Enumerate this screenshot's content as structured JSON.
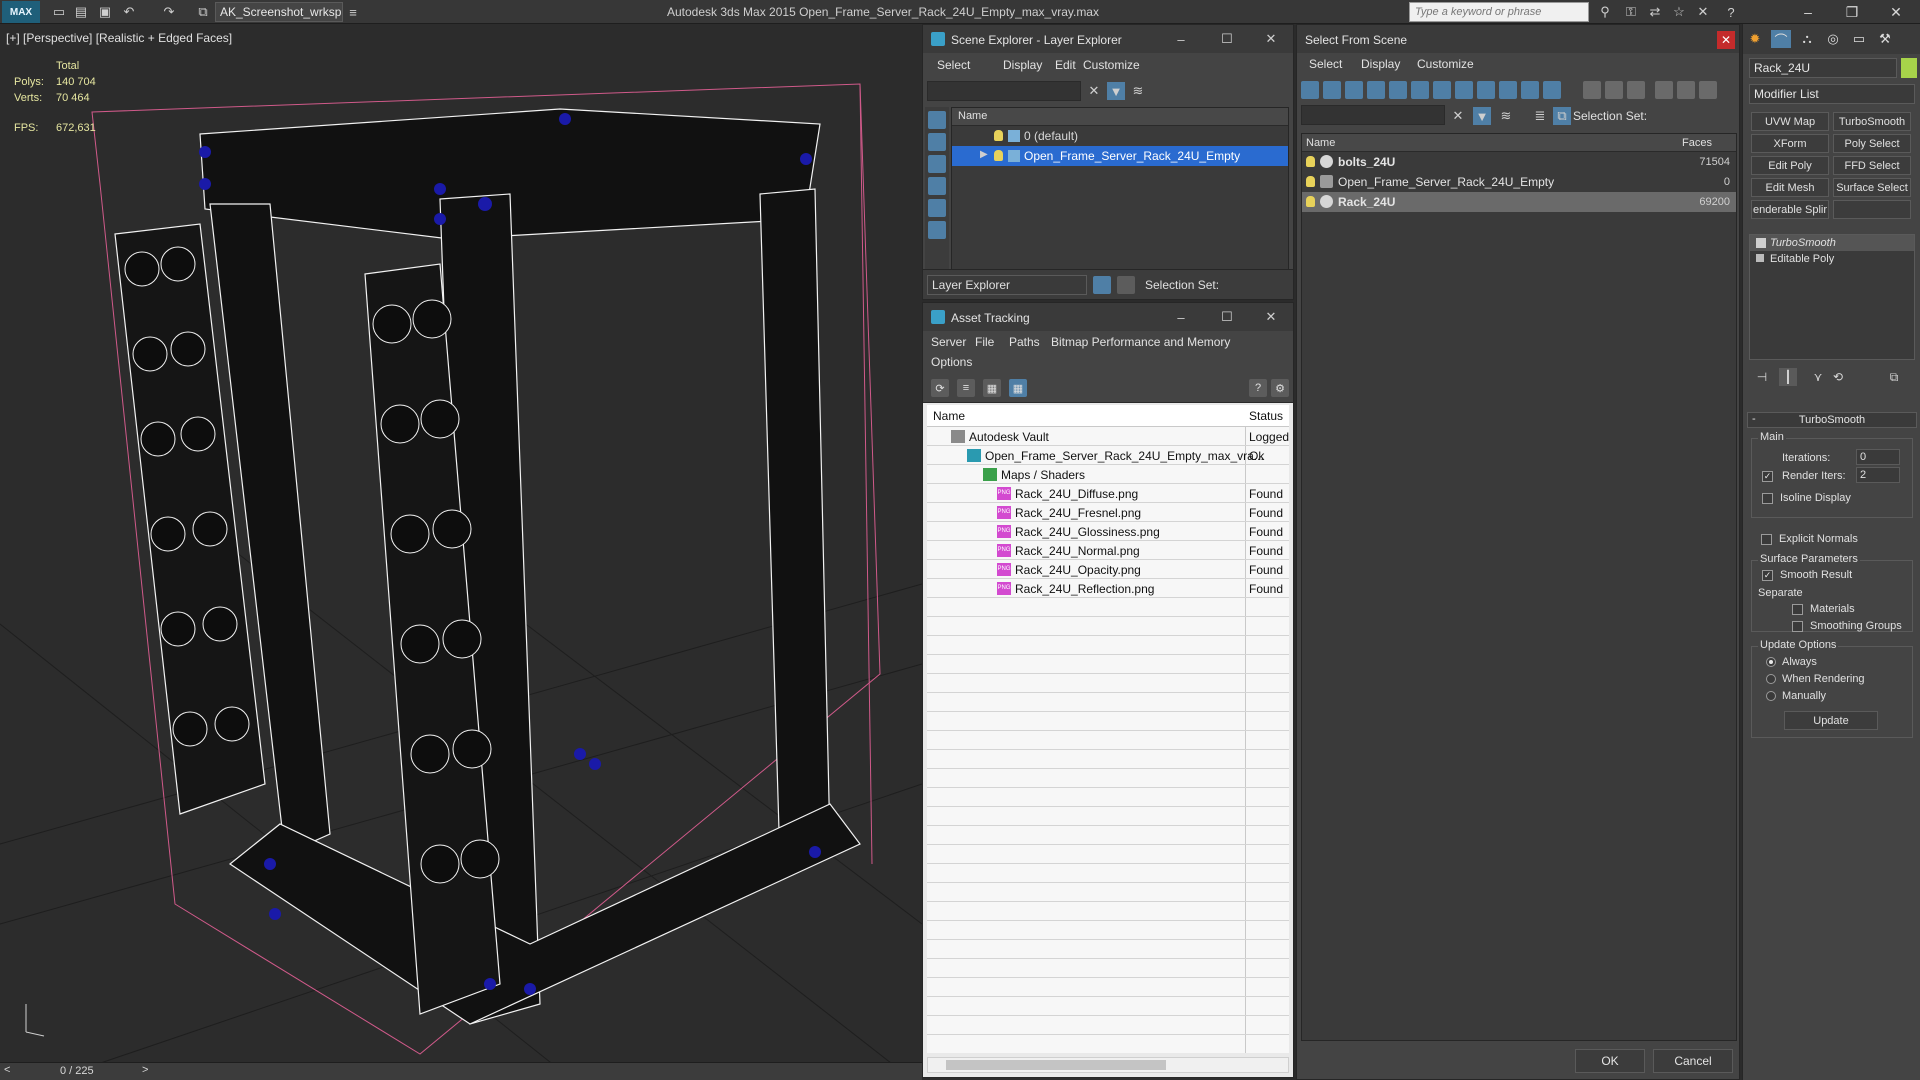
{
  "titlebar": {
    "logo": "MAX",
    "workspace": "AK_Screenshot_wrksp",
    "title": "Autodesk 3ds Max  2015     Open_Frame_Server_Rack_24U_Empty_max_vray.max",
    "search_placeholder": "Type a keyword or phrase"
  },
  "viewport": {
    "label": "[+] [Perspective] [Realistic + Edged Faces]",
    "stats": {
      "total_label": "Total",
      "polys_label": "Polys:",
      "polys": "140 704",
      "verts_label": "Verts:",
      "verts": "70 464",
      "fps_label": "FPS:",
      "fps": "672,631"
    },
    "timeline_frame": "0 / 225"
  },
  "scene_explorer": {
    "title": "Scene Explorer - Layer Explorer",
    "menus": [
      "Select",
      "Display",
      "Edit",
      "Customize"
    ],
    "column_name": "Name",
    "rows": [
      {
        "label": "0 (default)"
      },
      {
        "label": "Open_Frame_Server_Rack_24U_Empty"
      }
    ],
    "footer_dropdown": "Layer Explorer",
    "footer_selection_set": "Selection Set:"
  },
  "asset_tracking": {
    "title": "Asset Tracking",
    "menus": [
      "Server",
      "File",
      "Paths",
      "Bitmap Performance and Memory",
      "Options"
    ],
    "columns": [
      "Name",
      "Status"
    ],
    "rows": [
      {
        "name": "Autodesk Vault",
        "status": "Logged"
      },
      {
        "name": "Open_Frame_Server_Rack_24U_Empty_max_vra...",
        "status": "Ok"
      },
      {
        "name": "Maps / Shaders",
        "status": ""
      },
      {
        "name": "Rack_24U_Diffuse.png",
        "status": "Found"
      },
      {
        "name": "Rack_24U_Fresnel.png",
        "status": "Found"
      },
      {
        "name": "Rack_24U_Glossiness.png",
        "status": "Found"
      },
      {
        "name": "Rack_24U_Normal.png",
        "status": "Found"
      },
      {
        "name": "Rack_24U_Opacity.png",
        "status": "Found"
      },
      {
        "name": "Rack_24U_Reflection.png",
        "status": "Found"
      }
    ],
    "png_badge": "PNG"
  },
  "select_from_scene": {
    "title": "Select From Scene",
    "menus": [
      "Select",
      "Display",
      "Customize"
    ],
    "selection_set": "Selection Set:",
    "columns": [
      "Name",
      "Faces"
    ],
    "rows": [
      {
        "name": "bolts_24U",
        "faces": "71504"
      },
      {
        "name": "Open_Frame_Server_Rack_24U_Empty",
        "faces": "0"
      },
      {
        "name": "Rack_24U",
        "faces": "69200"
      }
    ],
    "ok": "OK",
    "cancel": "Cancel"
  },
  "command_panel": {
    "object_name": "Rack_24U",
    "modifier_list": "Modifier List",
    "modifier_buttons": [
      "UVW Map",
      "TurboSmooth",
      "XForm",
      "Poly Select",
      "Edit Poly",
      "FFD Select",
      "Edit Mesh",
      "Surface Select",
      "enderable Splir",
      ""
    ],
    "stack": [
      "TurboSmooth",
      "Editable Poly"
    ],
    "rollout_title": "TurboSmooth",
    "main_label": "Main",
    "iterations_label": "Iterations:",
    "iterations": "0",
    "render_iters_label": "Render Iters:",
    "render_iters": "2",
    "isoline_display": "Isoline Display",
    "explicit_normals": "Explicit Normals",
    "surface_params": "Surface Parameters",
    "smooth_result": "Smooth Result",
    "separate": "Separate",
    "materials": "Materials",
    "smoothing_groups": "Smoothing Groups",
    "update_options": "Update Options",
    "always": "Always",
    "when_rendering": "When Rendering",
    "manually": "Manually",
    "update": "Update"
  }
}
